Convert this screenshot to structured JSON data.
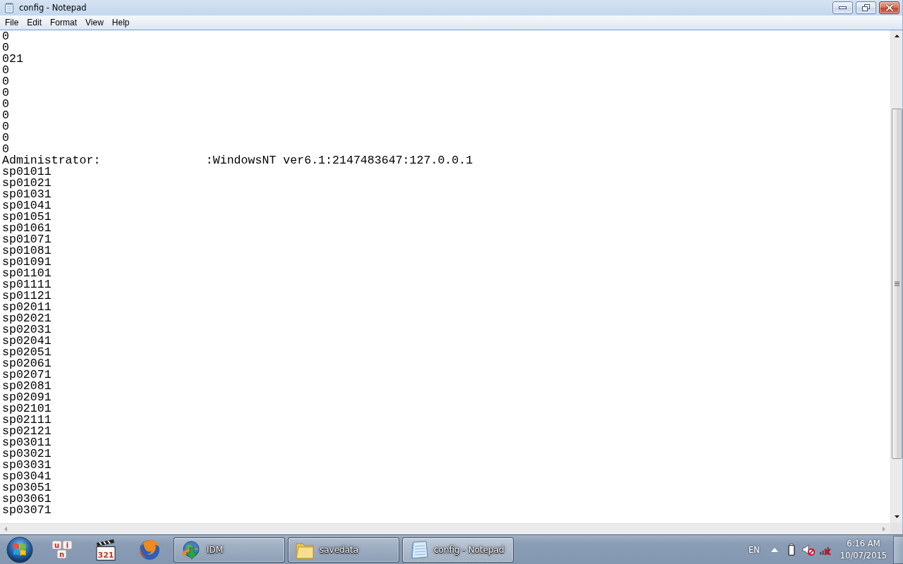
{
  "window": {
    "title": "config - Notepad"
  },
  "menu": [
    "File",
    "Edit",
    "Format",
    "View",
    "Help"
  ],
  "editor": {
    "lines": [
      {
        "kind": "text",
        "text": "0"
      },
      {
        "kind": "text",
        "text": "0"
      },
      {
        "kind": "text",
        "text": "021"
      },
      {
        "kind": "text",
        "text": "0"
      },
      {
        "kind": "text",
        "text": "0"
      },
      {
        "kind": "text",
        "text": "0"
      },
      {
        "kind": "text",
        "text": "0"
      },
      {
        "kind": "text",
        "text": "0"
      },
      {
        "kind": "text",
        "text": "0"
      },
      {
        "kind": "text",
        "text": "0"
      },
      {
        "kind": "text",
        "text": "0"
      },
      {
        "kind": "redacted",
        "before": "Administrator:",
        "after": ":WindowsNT ver6.1:2147483647:127.0.0.1"
      },
      {
        "kind": "text",
        "text": "sp01011"
      },
      {
        "kind": "text",
        "text": "sp01021"
      },
      {
        "kind": "text",
        "text": "sp01031"
      },
      {
        "kind": "text",
        "text": "sp01041"
      },
      {
        "kind": "text",
        "text": "sp01051"
      },
      {
        "kind": "text",
        "text": "sp01061"
      },
      {
        "kind": "text",
        "text": "sp01071"
      },
      {
        "kind": "text",
        "text": "sp01081"
      },
      {
        "kind": "text",
        "text": "sp01091"
      },
      {
        "kind": "text",
        "text": "sp01101"
      },
      {
        "kind": "text",
        "text": "sp01111"
      },
      {
        "kind": "text",
        "text": "sp01121"
      },
      {
        "kind": "text",
        "text": "sp02011"
      },
      {
        "kind": "text",
        "text": "sp02021"
      },
      {
        "kind": "text",
        "text": "sp02031"
      },
      {
        "kind": "text",
        "text": "sp02041"
      },
      {
        "kind": "text",
        "text": "sp02051"
      },
      {
        "kind": "text",
        "text": "sp02061"
      },
      {
        "kind": "text",
        "text": "sp02071"
      },
      {
        "kind": "text",
        "text": "sp02081"
      },
      {
        "kind": "text",
        "text": "sp02091"
      },
      {
        "kind": "text",
        "text": "sp02101"
      },
      {
        "kind": "text",
        "text": "sp02111"
      },
      {
        "kind": "text",
        "text": "sp02121"
      },
      {
        "kind": "text",
        "text": "sp03011"
      },
      {
        "kind": "text",
        "text": "sp03021"
      },
      {
        "kind": "text",
        "text": "sp03031"
      },
      {
        "kind": "text",
        "text": "sp03041"
      },
      {
        "kind": "text",
        "text": "sp03051"
      },
      {
        "kind": "text",
        "text": "sp03061"
      },
      {
        "kind": "text",
        "text": "sp03071"
      }
    ]
  },
  "taskbar": {
    "pinned": [
      {
        "kind": "key-tiles",
        "letters": [
          "u",
          "i",
          "n"
        ]
      },
      {
        "kind": "clapperboard",
        "label": "321"
      },
      {
        "kind": "globe"
      }
    ],
    "tasks": [
      {
        "label": "IDM",
        "selected": false
      },
      {
        "label": "savedata",
        "selected": false
      },
      {
        "label": "config - Notepad",
        "selected": true
      }
    ],
    "tray": {
      "language": "EN",
      "time": "6:16 AM",
      "date": "10/07/2015"
    }
  }
}
